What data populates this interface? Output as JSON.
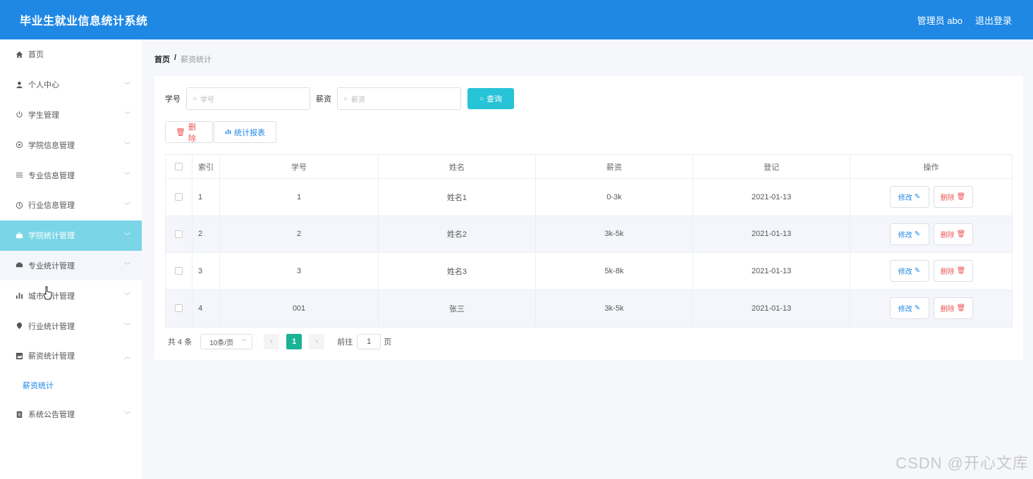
{
  "header": {
    "app_title": "毕业生就业信息统计系统",
    "user_label": "管理员 abo",
    "logout_label": "退出登录"
  },
  "sidebar": {
    "items": [
      {
        "label": "首页",
        "icon": "home-icon",
        "expandable": false
      },
      {
        "label": "个人中心",
        "icon": "user-icon",
        "expandable": true
      },
      {
        "label": "学生管理",
        "icon": "power-icon",
        "expandable": true
      },
      {
        "label": "学院信息管理",
        "icon": "settings-icon",
        "expandable": true
      },
      {
        "label": "专业信息管理",
        "icon": "sliders-icon",
        "expandable": true
      },
      {
        "label": "行业信息管理",
        "icon": "clock-icon",
        "expandable": true
      },
      {
        "label": "学院统计管理",
        "icon": "briefcase-icon",
        "expandable": true
      },
      {
        "label": "专业统计管理",
        "icon": "printer-icon",
        "expandable": true
      },
      {
        "label": "城市统计管理",
        "icon": "bar-chart-icon",
        "expandable": true
      },
      {
        "label": "行业统计管理",
        "icon": "location-icon",
        "expandable": true
      },
      {
        "label": "薪资统计管理",
        "icon": "picture-icon",
        "expandable": true,
        "expanded": true
      },
      {
        "label": "系统公告管理",
        "icon": "document-icon",
        "expandable": true
      }
    ],
    "sub_item": "薪资统计",
    "active_color": "#7ad6e6"
  },
  "breadcrumb": {
    "home": "首页",
    "separator": "/",
    "current": "薪资统计"
  },
  "search": {
    "student_id_label": "学号",
    "student_id_placeholder": "学号",
    "salary_label": "薪资",
    "salary_placeholder": "薪资",
    "query_button": "查询"
  },
  "actions": {
    "delete_label": "删除",
    "report_label": "统计报表"
  },
  "table": {
    "headers": [
      "索引",
      "学号",
      "姓名",
      "薪资",
      "登记",
      "操作"
    ],
    "rows": [
      {
        "index": "1",
        "student_id": "1",
        "name": "姓名1",
        "salary": "0-3k",
        "date": "2021-01-13"
      },
      {
        "index": "2",
        "student_id": "2",
        "name": "姓名2",
        "salary": "3k-5k",
        "date": "2021-01-13"
      },
      {
        "index": "3",
        "student_id": "3",
        "name": "姓名3",
        "salary": "5k-8k",
        "date": "2021-01-13"
      },
      {
        "index": "4",
        "student_id": "001",
        "name": "张三",
        "salary": "3k-5k",
        "date": "2021-01-13"
      }
    ],
    "edit_label": "修改",
    "delete_label": "删除"
  },
  "pagination": {
    "total": "共 4 条",
    "page_size": "10条/页",
    "current_page": "1",
    "goto_prefix": "前往",
    "goto_value": "1",
    "goto_suffix": "页"
  },
  "watermark": "CSDN @开心文库",
  "colors": {
    "header_bg": "#1f88e5",
    "query_btn": "#27c3d6",
    "active_page": "#1ab394"
  }
}
